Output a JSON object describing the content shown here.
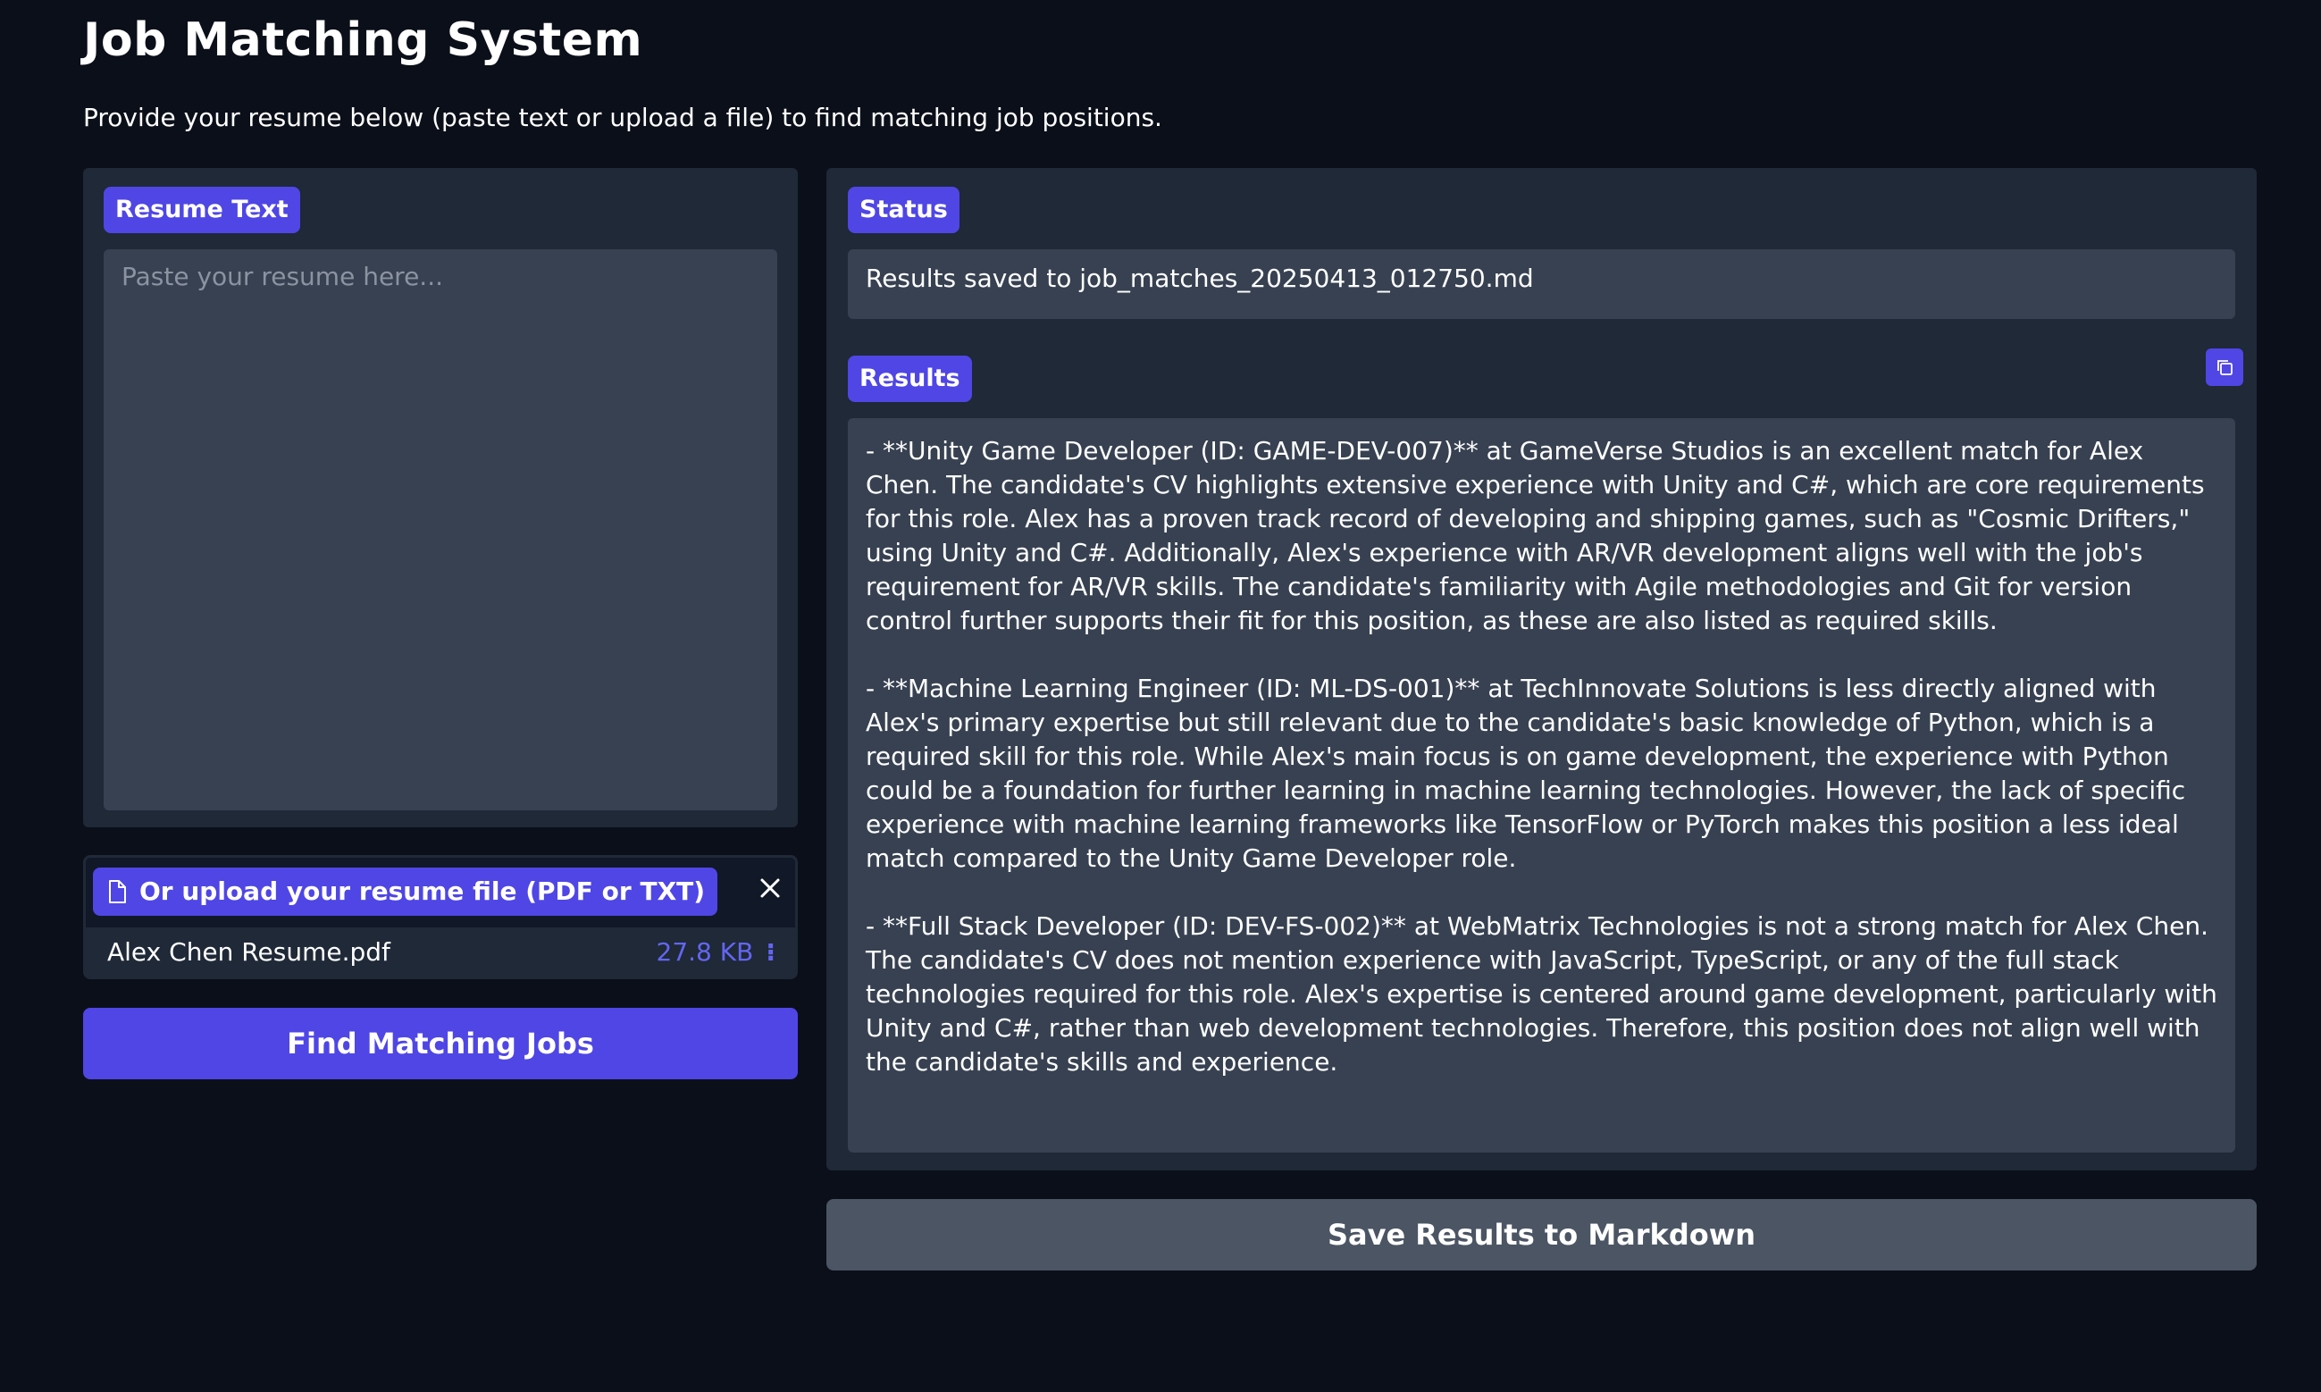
{
  "header": {
    "title": "Job Matching System",
    "subtitle": "Provide your resume below (paste text or upload a file) to find matching job positions."
  },
  "resume": {
    "label": "Resume Text",
    "placeholder": "Paste your resume here...",
    "value": ""
  },
  "upload": {
    "label": "Or upload your resume file (PDF or TXT)",
    "icon": "file-icon",
    "file_name": "Alex Chen Resume.pdf",
    "file_size": "27.8 KB",
    "file_menu_glyph": "⁝"
  },
  "find_button": {
    "label": "Find Matching Jobs"
  },
  "status": {
    "label": "Status",
    "value": "Results saved to job_matches_20250413_012750.md"
  },
  "results": {
    "label": "Results",
    "paragraphs": [
      "- **Unity Game Developer (ID: GAME-DEV-007)** at GameVerse Studios is an excellent match for Alex Chen. The candidate's CV highlights extensive experience with Unity and C#, which are core requirements for this role. Alex has a proven track record of developing and shipping games, such as \"Cosmic Drifters,\" using Unity and C#. Additionally, Alex's experience with AR/VR development aligns well with the job's requirement for AR/VR skills. The candidate's familiarity with Agile methodologies and Git for version control further supports their fit for this position, as these are also listed as required skills.",
      "- **Machine Learning Engineer (ID: ML-DS-001)** at TechInnovate Solutions is less directly aligned with Alex's primary expertise but still relevant due to the candidate's basic knowledge of Python, which is a required skill for this role. While Alex's main focus is on game development, the experience with Python could be a foundation for further learning in machine learning technologies. However, the lack of specific experience with machine learning frameworks like TensorFlow or PyTorch makes this position a less ideal match compared to the Unity Game Developer role.",
      "- **Full Stack Developer (ID: DEV-FS-002)** at WebMatrix Technologies is not a strong match for Alex Chen. The candidate's CV does not mention experience with JavaScript, TypeScript, or any of the full stack technologies required for this role. Alex's expertise is centered around game development, particularly with Unity and C#, rather than web development technologies. Therefore, this position does not align well with the candidate's skills and experience."
    ]
  },
  "save_button": {
    "label": "Save Results to Markdown"
  },
  "colors": {
    "background": "#0b0f19",
    "panel": "#1f2937",
    "input": "#374151",
    "accent": "#4f46e5",
    "secondary_button": "#4b5563"
  }
}
